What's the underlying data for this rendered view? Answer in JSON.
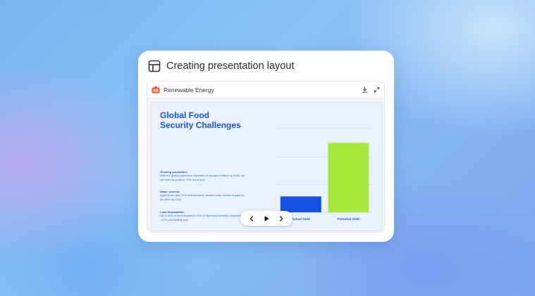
{
  "card": {
    "title": "Creating presentation layout"
  },
  "window": {
    "title": "Renewable Energy"
  },
  "slide": {
    "title_line1": "Global Food",
    "title_line2": "Security Challenges",
    "bullets": [
      {
        "heading": "Growing population:",
        "body": "With the global population expected to surpass 9 billion by 2050, we will need to produce 70% more food"
      },
      {
        "heading": "Water scarcity:",
        "body": "Agriculture uses 70% of freshwater; demand may exceed supply by 40–50% by 2030"
      },
      {
        "heading": "Land degradation:",
        "body": "Up to 40% of land degraded; 52% of farmland severely degraded; ~20% productivity loss"
      }
    ]
  },
  "chart_data": {
    "type": "bar",
    "categories": [
      "Actual Yield",
      "Potential Yield"
    ],
    "values": [
      19,
      83
    ],
    "colors": [
      "#1553e6",
      "#a6e83c"
    ],
    "ylim": [
      0,
      100
    ],
    "grid": true,
    "legend": "none"
  },
  "colors": {
    "title": "#1a56db",
    "body": "#2f6be0",
    "slide_bg": "#e9f1fe"
  },
  "icons": {
    "header": "layout-icon",
    "window": "presentation-icon",
    "download": "download-icon",
    "expand": "expand-icon",
    "prev": "chevron-left-icon",
    "play": "play-icon",
    "next": "chevron-right-icon"
  }
}
